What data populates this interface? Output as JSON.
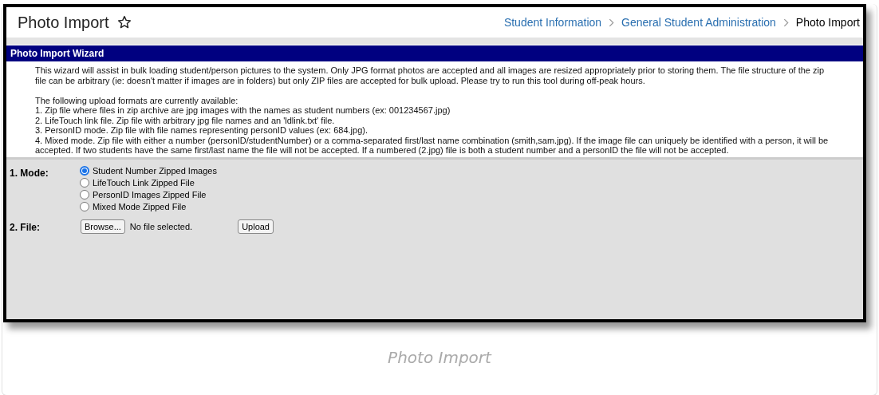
{
  "header": {
    "title": "Photo Import",
    "breadcrumbs": [
      {
        "label": "Student Information",
        "link": true
      },
      {
        "label": "General Student Administration",
        "link": true
      },
      {
        "label": "Photo Import",
        "link": false
      }
    ]
  },
  "wizard": {
    "title": "Photo Import Wizard",
    "intro": "This wizard will assist in bulk loading student/person pictures to the system. Only JPG format photos are accepted and all images are resized appropriately prior to storing them. The file structure of the zip file can be arbitrary (ie: doesn't matter if images are in folders) but only ZIP files are accepted for bulk upload. Please try to run this tool during off-peak hours.",
    "formats_heading": "The following upload formats are currently available:",
    "formats": [
      "1. Zip file where files in zip archive are jpg images with the names as student numbers (ex: 001234567.jpg)",
      "2. LifeTouch link file. Zip file with arbitrary jpg file names and an 'ldlink.txt' file.",
      "3. PersonID mode. Zip file with file names representing personID values (ex: 684.jpg).",
      "4. Mixed mode. Zip file with either a number (personID/studentNumber) or a comma-separated first/last name combination (smith,sam.jpg). If the image file can uniquely be identified with a person, it will be accepted. If two students have the same first/last name the file will not be accepted. If a numbered (2.jpg) file is both a student number and a personID the file will not be accepted."
    ],
    "mode_label": "1. Mode:",
    "modes": [
      {
        "label": "Student Number Zipped Images",
        "selected": true
      },
      {
        "label": "LifeTouch Link Zipped File",
        "selected": false
      },
      {
        "label": "PersonID Images Zipped File",
        "selected": false
      },
      {
        "label": "Mixed Mode Zipped File",
        "selected": false
      }
    ],
    "file_label": "2. File:",
    "browse_button": "Browse...",
    "file_status": "No file selected.",
    "upload_button": "Upload"
  },
  "caption": "Photo Import"
}
